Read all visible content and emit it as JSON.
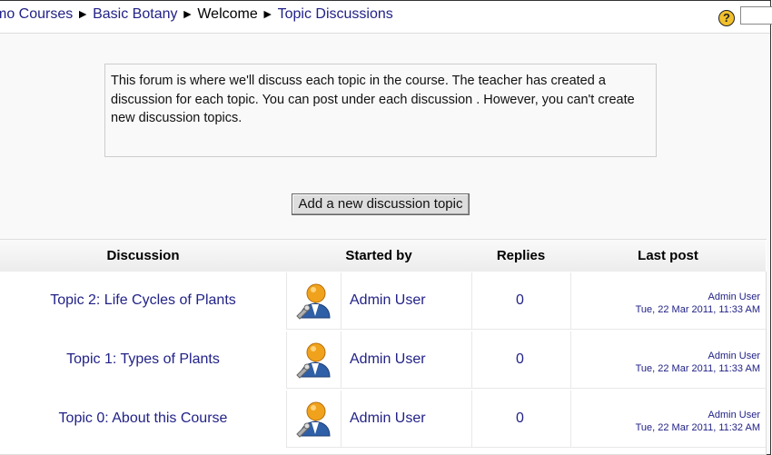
{
  "breadcrumb": {
    "item0": "mo Courses",
    "item1": "Basic Botany",
    "item2": "Welcome",
    "item3": "Topic Discussions",
    "separator": "►"
  },
  "help": {
    "glyph": "?"
  },
  "intro": {
    "text": "This forum is where we'll discuss each topic in the course. The teacher has created a discussion for each topic. You can post under each discussion . However, you can't create new discussion topics."
  },
  "actions": {
    "add_topic": "Add a new discussion topic"
  },
  "table": {
    "headers": {
      "discussion": "Discussion",
      "started_by": "Started by",
      "replies": "Replies",
      "last_post": "Last post"
    },
    "rows": [
      {
        "topic": "Topic 2: Life Cycles of Plants",
        "author": "Admin User",
        "replies": "0",
        "last_user": "Admin User",
        "last_date": "Tue, 22 Mar 2011, 11:33 AM"
      },
      {
        "topic": "Topic 1: Types of Plants",
        "author": "Admin User",
        "replies": "0",
        "last_user": "Admin User",
        "last_date": "Tue, 22 Mar 2011, 11:33 AM"
      },
      {
        "topic": "Topic 0: About this Course",
        "author": "Admin User",
        "replies": "0",
        "last_user": "Admin User",
        "last_date": "Tue, 22 Mar 2011, 11:32 AM"
      }
    ]
  },
  "colors": {
    "link": "#222288",
    "help_icon": "#f2c02c"
  },
  "icons": {
    "help": "help-icon",
    "avatar": "admin-user-avatar-icon"
  }
}
